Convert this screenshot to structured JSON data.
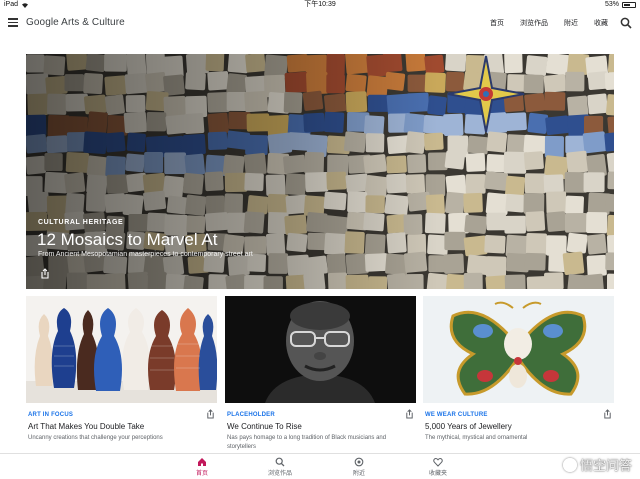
{
  "status_bar": {
    "device": "iPad",
    "time": "下午10:39",
    "battery": "53%"
  },
  "header": {
    "brand": "Google Arts & Culture",
    "nav": [
      "首页",
      "浏览作品",
      "附近",
      "收藏"
    ]
  },
  "hero": {
    "kicker": "CULTURAL HERITAGE",
    "title": "12 Mosaics to Marvel At",
    "subtitle": "From Ancient Mesopotamian masterpieces to contemporary street art"
  },
  "cards": [
    {
      "kicker": "ART IN FOCUS",
      "title": "Art That Makes You Double Take",
      "description": "Uncanny creations that challenge your perceptions"
    },
    {
      "kicker": "PLACEHOLDER",
      "title": "We Continue To Rise",
      "description": "Nas pays homage to a long tradition of Black musicians and storytellers"
    },
    {
      "kicker": "WE WEAR CULTURE",
      "title": "5,000 Years of Jewellery",
      "description": "The mythical, mystical and ornamental"
    }
  ],
  "bottom_nav": [
    {
      "label": "首页",
      "icon": "home-icon",
      "active": true
    },
    {
      "label": "浏览作品",
      "icon": "search-icon",
      "active": false
    },
    {
      "label": "附近",
      "icon": "nearby-icon",
      "active": false
    },
    {
      "label": "收藏夹",
      "icon": "heart-icon",
      "active": false
    }
  ],
  "watermark": "悟空问答",
  "colors": {
    "accent_blue": "#1a73e8",
    "active_pink": "#c2185b"
  }
}
